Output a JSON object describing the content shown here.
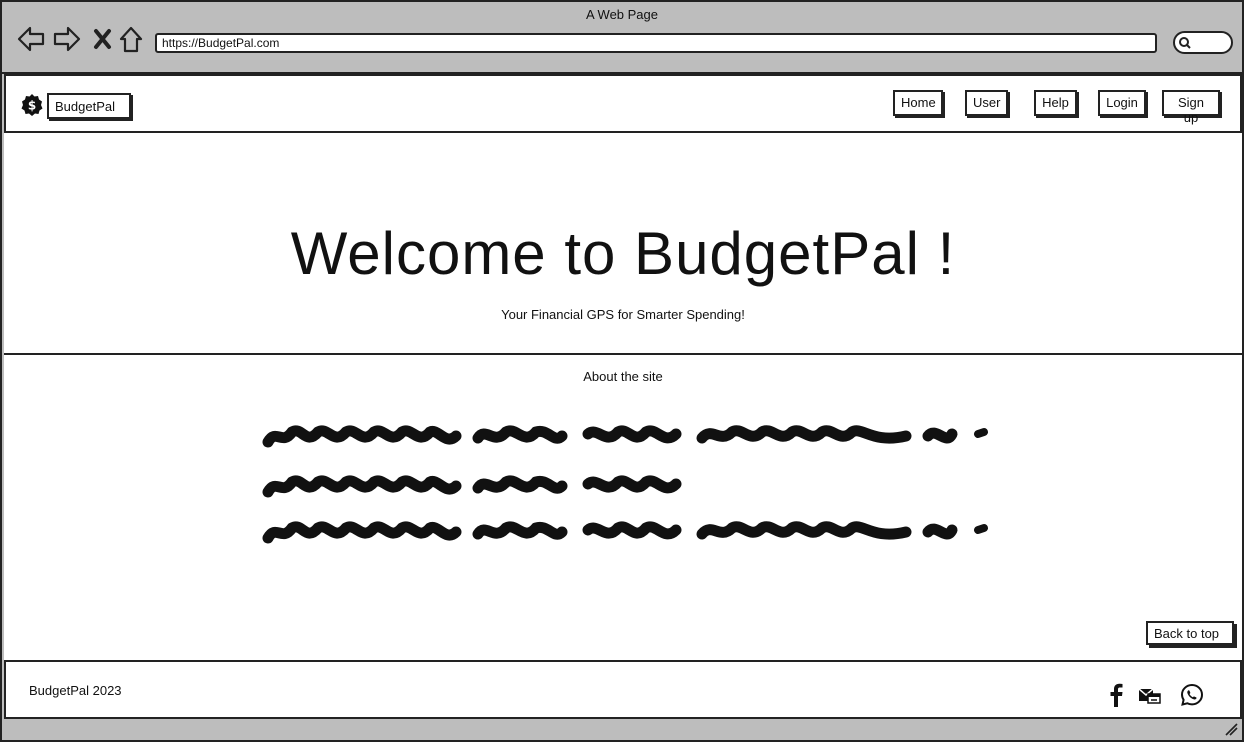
{
  "window": {
    "title": "A Web Page",
    "url": "https://BudgetPal.com"
  },
  "header": {
    "brand": "BudgetPal",
    "nav": [
      {
        "label": "Home"
      },
      {
        "label": "User"
      },
      {
        "label": "Help"
      },
      {
        "label": "Login"
      },
      {
        "label": "Sign up"
      }
    ]
  },
  "hero": {
    "title": "Welcome to BudgetPal !",
    "tagline": "Your Financial GPS for Smarter Spending!"
  },
  "about": {
    "title": "About the site"
  },
  "back_to_top": "Back to top",
  "footer": {
    "text": "BudgetPal 2023",
    "social": [
      "facebook-icon",
      "mail-icon",
      "whatsapp-icon"
    ]
  },
  "icons": [
    "back-arrow-icon",
    "forward-arrow-icon",
    "close-icon",
    "home-icon",
    "search-icon",
    "dollar-logo-icon"
  ]
}
